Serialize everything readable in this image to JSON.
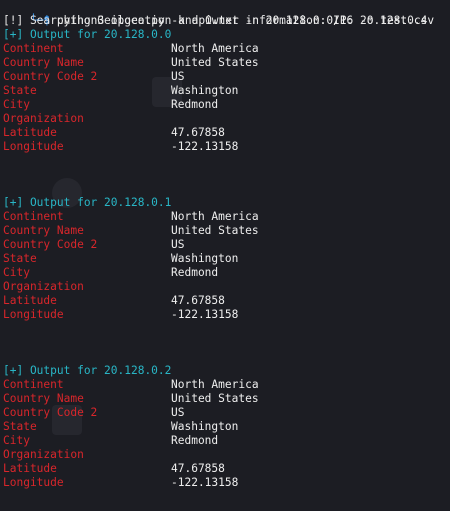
{
  "command": {
    "corner": "└─",
    "dollar": "$",
    "text": " python3 ipgeo.py -k api.txt -n 20.128.0.0/16 -o test.csv"
  },
  "status_line": "[!] Searching Geolocation and Owner information: IP: 20.128.0.4",
  "blocks": [
    {
      "header": "[+] Output for 20.128.0.0",
      "rows": [
        {
          "key": "Continent",
          "value": "North America"
        },
        {
          "key": "Country Name",
          "value": "United States"
        },
        {
          "key": "Country Code 2",
          "value": "US"
        },
        {
          "key": "State",
          "value": "Washington"
        },
        {
          "key": "City",
          "value": "Redmond"
        },
        {
          "key": "Organization",
          "value": ""
        },
        {
          "key": "Latitude",
          "value": "47.67858"
        },
        {
          "key": "Longitude",
          "value": "-122.13158"
        }
      ]
    },
    {
      "header": "[+] Output for 20.128.0.1",
      "rows": [
        {
          "key": "Continent",
          "value": "North America"
        },
        {
          "key": "Country Name",
          "value": "United States"
        },
        {
          "key": "Country Code 2",
          "value": "US"
        },
        {
          "key": "State",
          "value": "Washington"
        },
        {
          "key": "City",
          "value": "Redmond"
        },
        {
          "key": "Organization",
          "value": ""
        },
        {
          "key": "Latitude",
          "value": "47.67858"
        },
        {
          "key": "Longitude",
          "value": "-122.13158"
        }
      ]
    },
    {
      "header": "[+] Output for 20.128.0.2",
      "rows": [
        {
          "key": "Continent",
          "value": "North America"
        },
        {
          "key": "Country Name",
          "value": "United States"
        },
        {
          "key": "Country Code 2",
          "value": "US"
        },
        {
          "key": "State",
          "value": "Washington"
        },
        {
          "key": "City",
          "value": "Redmond"
        },
        {
          "key": "Organization",
          "value": ""
        },
        {
          "key": "Latitude",
          "value": "47.67858"
        },
        {
          "key": "Longitude",
          "value": "-122.13158"
        }
      ]
    }
  ],
  "colors": {
    "background": "#1c1d23",
    "prompt": "#3aa0ff",
    "header": "#29b6c6",
    "key": "#d8262b",
    "value": "#eeeeee"
  }
}
